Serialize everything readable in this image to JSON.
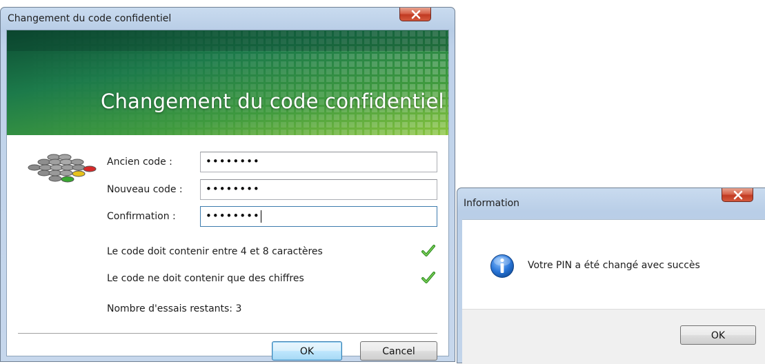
{
  "pin_dialog": {
    "title": "Changement du code confidentiel",
    "banner_title": "Changement du code confidentiel",
    "fields": [
      {
        "label": "Ancien code :",
        "value": "••••••••"
      },
      {
        "label": "Nouveau code :",
        "value": "••••••••"
      },
      {
        "label": "Confirmation :",
        "value": "••••••••"
      }
    ],
    "rules": [
      {
        "text": "Le code doit contenir entre 4 et 8 caractères",
        "status": "check-icon"
      },
      {
        "text": "Le code ne doit contenir que des chiffres",
        "status": "check-icon"
      }
    ],
    "tries_text": "Nombre d'essais restants: 3",
    "ok_label": "OK",
    "cancel_label": "Cancel"
  },
  "info_dialog": {
    "title": "Information",
    "message": "Votre PIN a été changé avec succès",
    "icon": "info-icon",
    "ok_label": "OK"
  },
  "colors": {
    "banner_dark": "#0d4d33",
    "banner_light": "#8bc53f",
    "close_button": "#c13a22",
    "check_green": "#3fa12e",
    "info_blue": "#1f6fd1"
  }
}
